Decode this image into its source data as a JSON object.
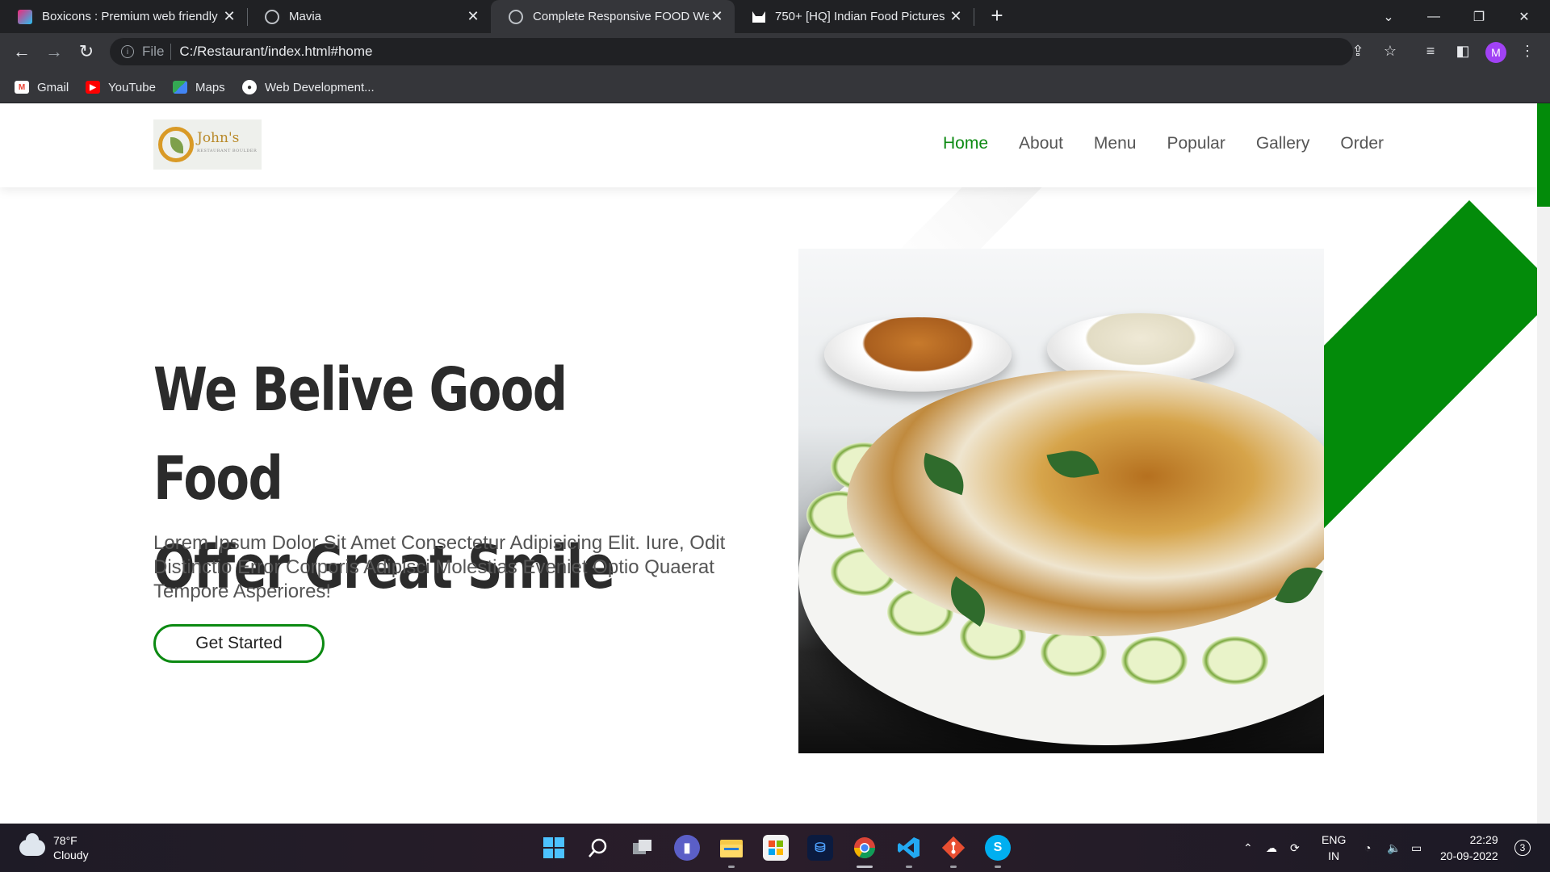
{
  "browser": {
    "tabs": [
      {
        "title": "Boxicons : Premium web friendly",
        "favicon": "boxicons-icon",
        "active": false
      },
      {
        "title": "Mavia",
        "favicon": "globe-icon",
        "active": false
      },
      {
        "title": "Complete Responsive FOOD Wel",
        "favicon": "globe-icon",
        "active": true
      },
      {
        "title": "750+ [HQ] Indian Food Pictures |",
        "favicon": "unsplash-icon",
        "active": false
      }
    ],
    "address": {
      "scheme": "File",
      "url": "C:/Restaurant/index.html#home"
    },
    "profile_initial": "M",
    "bookmarks": [
      {
        "label": "Gmail",
        "icon": "gmail-icon"
      },
      {
        "label": "YouTube",
        "icon": "youtube-icon"
      },
      {
        "label": "Maps",
        "icon": "maps-icon"
      },
      {
        "label": "Web Development...",
        "icon": "bookmark-folder-icon"
      }
    ]
  },
  "site": {
    "logo": {
      "name": "John's",
      "tagline": "RESTAURANT BOULDER"
    },
    "nav": [
      {
        "label": "Home",
        "active": true
      },
      {
        "label": "About",
        "active": false
      },
      {
        "label": "Menu",
        "active": false
      },
      {
        "label": "Popular",
        "active": false
      },
      {
        "label": "Gallery",
        "active": false
      },
      {
        "label": "Order",
        "active": false
      }
    ],
    "hero": {
      "title_line1": "We Belive Good Food",
      "title_line2": "Offer Great Smile",
      "text": "Lorem Ipsum Dolor Sit Amet Consectetur Adipisicing Elit. Iure, Odit Distinctio Error Corporis Adipisci Molestias Eveniet Optio Quaerat Tempore Asperiores!",
      "cta_label": "Get Started"
    },
    "colors": {
      "accent": "#038b0a",
      "text": "#2b2b2b"
    }
  },
  "taskbar": {
    "weather": {
      "temp": "78°F",
      "condition": "Cloudy"
    },
    "apps": [
      "windows-start-icon",
      "search-icon",
      "task-view-icon",
      "teams-chat-icon",
      "file-explorer-icon",
      "microsoft-store-icon",
      "azure-data-studio-icon",
      "chrome-icon",
      "vscode-icon",
      "git-icon",
      "skype-icon"
    ],
    "language": {
      "line1": "ENG",
      "line2": "IN"
    },
    "time": "22:29",
    "date": "20-09-2022",
    "notifications": "3"
  }
}
